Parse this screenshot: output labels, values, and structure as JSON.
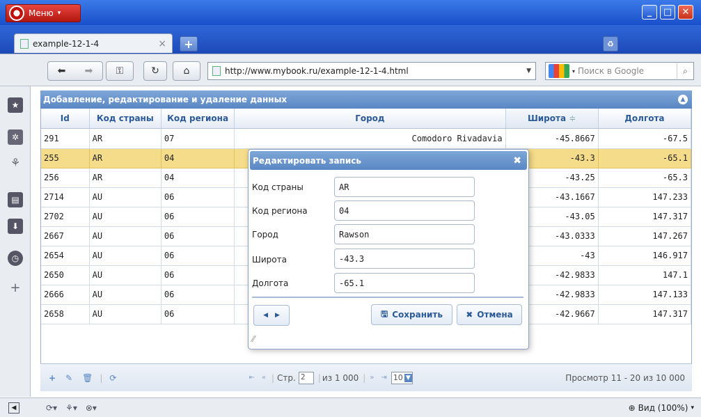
{
  "browser": {
    "menu_label": "Меню",
    "tab_title": "example-12-1-4",
    "url": "http://www.mybook.ru/example-12-1-4.html",
    "search_placeholder": "Поиск в Google",
    "zoom_label": "Вид (100%)"
  },
  "grid": {
    "caption": "Добавление, редактирование и удаление данных",
    "columns": [
      "Id",
      "Код страны",
      "Код региона",
      "Город",
      "Широта",
      "Долгота"
    ],
    "sort_indicator": "≑",
    "rows": [
      [
        "291",
        "AR",
        "07",
        "Comodoro Rivadavia",
        "-45.8667",
        "-67.5"
      ],
      [
        "255",
        "AR",
        "04",
        "",
        "-43.3",
        "-65.1"
      ],
      [
        "256",
        "AR",
        "04",
        "",
        "-43.25",
        "-65.3"
      ],
      [
        "2714",
        "AU",
        "06",
        "",
        "-43.1667",
        "147.233"
      ],
      [
        "2702",
        "AU",
        "06",
        "",
        "-43.05",
        "147.317"
      ],
      [
        "2667",
        "AU",
        "06",
        "",
        "-43.0333",
        "147.267"
      ],
      [
        "2654",
        "AU",
        "06",
        "",
        "-43",
        "146.917"
      ],
      [
        "2650",
        "AU",
        "06",
        "",
        "-42.9833",
        "147.1"
      ],
      [
        "2666",
        "AU",
        "06",
        "",
        "-42.9833",
        "147.133"
      ],
      [
        "2658",
        "AU",
        "06",
        "",
        "-42.9667",
        "147.317"
      ]
    ],
    "selected_row": 1
  },
  "pager": {
    "page_label": "Стр.",
    "page_value": "2",
    "of_label": "из 1 000",
    "page_size": "10",
    "summary": "Просмотр 11 - 20 из 10 000"
  },
  "dialog": {
    "title": "Редактировать запись",
    "fields": [
      {
        "label": "Код страны",
        "value": "AR"
      },
      {
        "label": "Код региона",
        "value": "04"
      },
      {
        "label": "Город",
        "value": "Rawson"
      },
      {
        "label": "Широта",
        "value": "-43.3"
      },
      {
        "label": "Долгота",
        "value": "-65.1"
      }
    ],
    "save_label": "Сохранить",
    "cancel_label": "Отмена"
  }
}
